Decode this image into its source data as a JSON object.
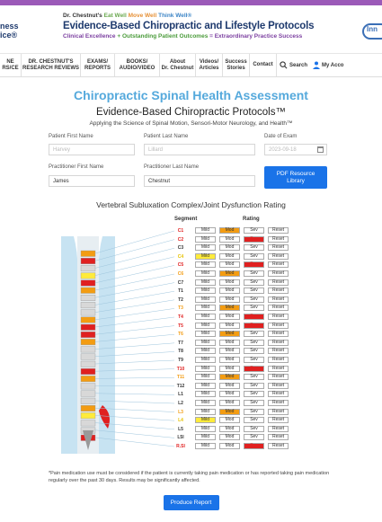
{
  "header": {
    "logo_left_line1": "ness",
    "logo_left_line2": "ice®",
    "tagline_prefix": "Dr. Chestnut's",
    "tagline_eat": "Eat Well",
    "tagline_move": "Move Well",
    "tagline_think": "Think Well®",
    "title": "Evidence-Based Chiropractic and Lifestyle Protocols",
    "subtitle_a": "Clinical Excellence",
    "subtitle_b": "+ Outstanding Patient Outcomes",
    "subtitle_c": "= Extraordinary Practice Success",
    "logo_right": "Inn"
  },
  "nav": {
    "items": [
      "NE\nRS/CE",
      "DR. CHESTNUT'S\nRESEARCH REVIEWS",
      "EXAMS/\nREPORTS",
      "BOOKS/\nAUDIO/VIDEO",
      "About\nDr. Chestnut",
      "Videos/\nArticles",
      "Success\nStories",
      "Contact"
    ],
    "search_label": "Search",
    "account_label": "My Acco"
  },
  "page": {
    "title": "Chiropractic Spinal Health Assessment",
    "subtitle": "Evidence-Based Chiropractic Protocols™",
    "tagline": "Applying the Science of Spinal Motion, Sensori-Motor Neurology, and Health™"
  },
  "form": {
    "first_name_label": "Patient First Name",
    "first_name_placeholder": "Harvey",
    "last_name_label": "Patient Last Name",
    "last_name_placeholder": "Lillard",
    "date_label": "Date of Exam",
    "date_placeholder": "2023-09-18",
    "pr_first_label": "Practitioner First Name",
    "pr_first_value": "James",
    "pr_last_label": "Practitioner Last Name",
    "pr_last_value": "Chestnut",
    "pdf_button": "PDF Resource\nLibrary"
  },
  "assessment": {
    "title": "Vertebral Subluxation Complex/Joint Dysfunction Rating",
    "segment_header": "Segment",
    "rating_header": "Rating",
    "btn_mild": "Mild",
    "btn_mod": "Mod",
    "btn_sev": "Sev",
    "btn_reset": "Reset",
    "segments": [
      {
        "name": "C1",
        "rating": "mod",
        "color": "#e02020"
      },
      {
        "name": "C2",
        "rating": "sev",
        "color": "#e02020"
      },
      {
        "name": "C3",
        "rating": "none",
        "color": "#333333"
      },
      {
        "name": "C4",
        "rating": "mild",
        "color": "#e6c200"
      },
      {
        "name": "C5",
        "rating": "sev",
        "color": "#e02020"
      },
      {
        "name": "C6",
        "rating": "mod",
        "color": "#f39c12"
      },
      {
        "name": "C7",
        "rating": "none",
        "color": "#333333"
      },
      {
        "name": "T1",
        "rating": "none",
        "color": "#333333"
      },
      {
        "name": "T2",
        "rating": "none",
        "color": "#333333"
      },
      {
        "name": "T3",
        "rating": "mod",
        "color": "#f39c12"
      },
      {
        "name": "T4",
        "rating": "sev",
        "color": "#e02020"
      },
      {
        "name": "T5",
        "rating": "sev",
        "color": "#e02020"
      },
      {
        "name": "T6",
        "rating": "mod",
        "color": "#f39c12"
      },
      {
        "name": "T7",
        "rating": "none",
        "color": "#333333"
      },
      {
        "name": "T8",
        "rating": "none",
        "color": "#333333"
      },
      {
        "name": "T9",
        "rating": "none",
        "color": "#333333"
      },
      {
        "name": "T10",
        "rating": "sev",
        "color": "#e02020"
      },
      {
        "name": "T11",
        "rating": "mod",
        "color": "#f39c12"
      },
      {
        "name": "T12",
        "rating": "none",
        "color": "#333333"
      },
      {
        "name": "L1",
        "rating": "none",
        "color": "#333333"
      },
      {
        "name": "L2",
        "rating": "none",
        "color": "#333333"
      },
      {
        "name": "L3",
        "rating": "mod",
        "color": "#f39c12"
      },
      {
        "name": "L4",
        "rating": "mild",
        "color": "#e6c200"
      },
      {
        "name": "L5",
        "rating": "none",
        "color": "#333333"
      },
      {
        "name": "L5I",
        "rating": "none",
        "color": "#333333"
      },
      {
        "name": "R.SI",
        "rating": "sev",
        "color": "#e02020"
      }
    ]
  },
  "footnote": "*Pain medication use must be considered if the patient is currently taking pain medication or has reported taking pain medication regularly over the past 30 days. Results may be significantly affected.",
  "produce_button": "Produce Report",
  "colors": {
    "accent": "#1a73e8",
    "title_blue": "#55a9dc",
    "purple": "#9b5ab8"
  }
}
